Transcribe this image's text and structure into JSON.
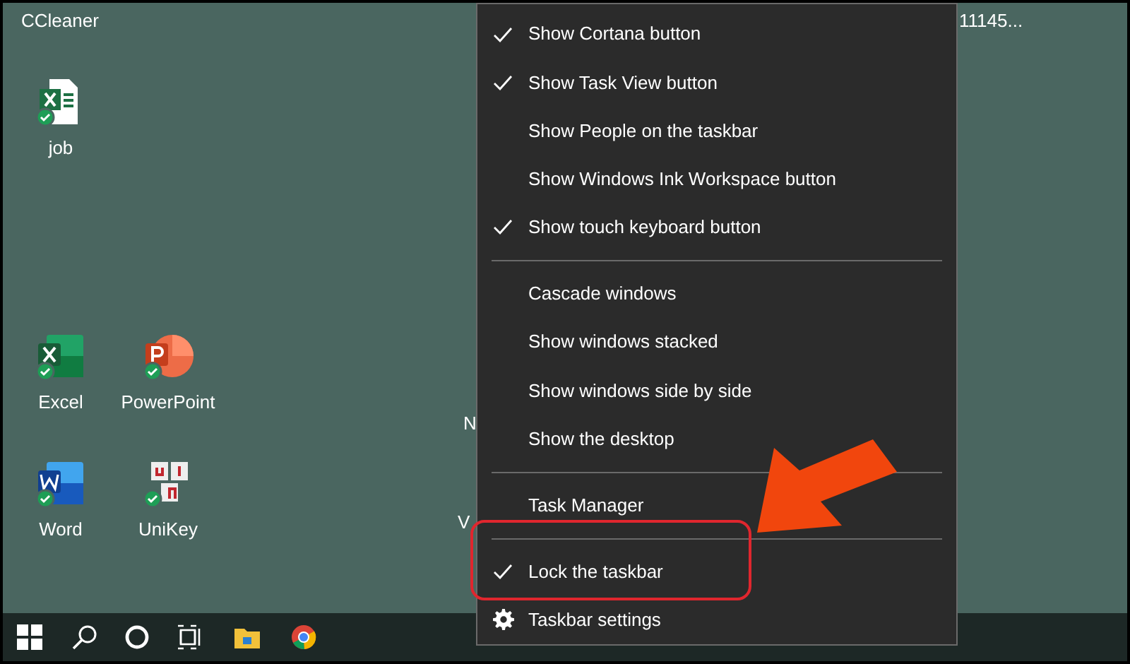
{
  "desktop": {
    "top_label": "CCleaner",
    "corner_label": "11145...",
    "icons": [
      {
        "label": "job",
        "kind": "excel_file"
      },
      {
        "label": "Excel",
        "kind": "excel"
      },
      {
        "label": "PowerPoint",
        "kind": "powerpoint"
      },
      {
        "label": "Word",
        "kind": "word"
      },
      {
        "label": "UniKey",
        "kind": "unikey"
      }
    ],
    "partial_labels": [
      "N",
      "V"
    ]
  },
  "context_menu": {
    "items": [
      {
        "kind": "option",
        "label": "Show Cortana button",
        "checked": true
      },
      {
        "kind": "option",
        "label": "Show Task View button",
        "checked": true
      },
      {
        "kind": "option",
        "label": "Show People on the taskbar",
        "checked": false
      },
      {
        "kind": "option",
        "label": "Show Windows Ink Workspace button",
        "checked": false
      },
      {
        "kind": "option",
        "label": "Show touch keyboard button",
        "checked": true
      },
      {
        "kind": "separator"
      },
      {
        "kind": "option",
        "label": "Cascade windows",
        "checked": false
      },
      {
        "kind": "option",
        "label": "Show windows stacked",
        "checked": false
      },
      {
        "kind": "option",
        "label": "Show windows side by side",
        "checked": false
      },
      {
        "kind": "option",
        "label": "Show the desktop",
        "checked": false
      },
      {
        "kind": "separator"
      },
      {
        "kind": "option",
        "label": "Task Manager",
        "checked": false
      },
      {
        "kind": "separator"
      },
      {
        "kind": "option",
        "label": "Lock the taskbar",
        "checked": true,
        "highlighted": true
      },
      {
        "kind": "settings",
        "label": "Taskbar settings"
      }
    ]
  }
}
